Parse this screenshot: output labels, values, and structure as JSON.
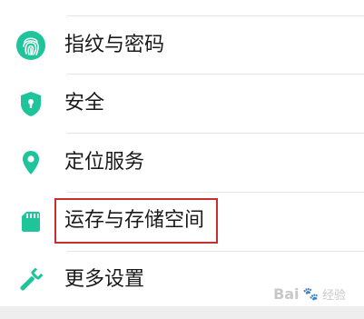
{
  "settings": {
    "items": [
      {
        "label": "指纹与密码",
        "icon": "fingerprint-icon"
      },
      {
        "label": "安全",
        "icon": "shield-icon"
      },
      {
        "label": "定位服务",
        "icon": "location-pin-icon"
      },
      {
        "label": "运存与存储空间",
        "icon": "sd-card-icon"
      },
      {
        "label": "更多设置",
        "icon": "wrench-icon"
      }
    ]
  },
  "colors": {
    "icon_accent": "#1fc49a",
    "highlight": "#c62f2f",
    "text": "#1a1a1a",
    "divider": "#e4e4e4"
  },
  "watermark": {
    "brand": "Bai",
    "paw": "🐾",
    "suffix": "经验"
  }
}
